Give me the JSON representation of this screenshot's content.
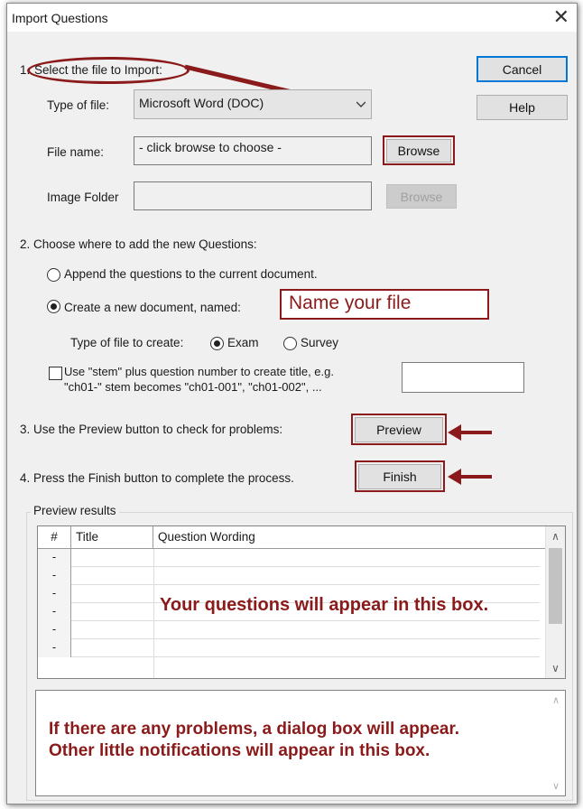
{
  "window": {
    "title": "Import Questions",
    "close_glyph": "✕"
  },
  "step1": {
    "number": "1.",
    "label": "Select the file to Import:",
    "type_label": "Type of file:",
    "type_value": "Microsoft Word (DOC)",
    "file_label": "File name:",
    "file_value": "- click browse to choose -",
    "browse_label": "Browse",
    "image_folder_label": "Image Folder",
    "image_folder_value": "",
    "image_browse_label": "Browse"
  },
  "buttons": {
    "cancel": "Cancel",
    "help": "Help"
  },
  "step2": {
    "label": "2. Choose where to add the new Questions:",
    "append_label": "Append the questions to the current document.",
    "create_label": "Create a new document, named:",
    "name_value": "Name your file",
    "type_to_create_label": "Type of file to create:",
    "exam_label": "Exam",
    "survey_label": "Survey",
    "stem_line1": "Use \"stem\" plus question number to create title,  e.g.",
    "stem_line2": "\"ch01-\" stem becomes \"ch01-001\",  \"ch01-002\",  ...",
    "stem_value": ""
  },
  "step3": {
    "label": "3. Use the Preview button to check for problems:",
    "button": "Preview"
  },
  "step4": {
    "label": "4. Press the Finish button to complete the process.",
    "button": "Finish"
  },
  "preview": {
    "group_label": "Preview results",
    "columns": [
      "#",
      "Title",
      "Question Wording"
    ],
    "row_markers": [
      "-",
      "-",
      "-",
      "-",
      "-",
      "-"
    ],
    "overlay": "Your questions will appear in this box."
  },
  "notes": {
    "line1": "If there are any problems, a dialog box will appear.",
    "line2": "Other little notifications will appear in this box."
  },
  "colors": {
    "annotation": "#8b1a1a",
    "accent": "#0078d7",
    "dialog_bg": "#f0f0f0"
  }
}
